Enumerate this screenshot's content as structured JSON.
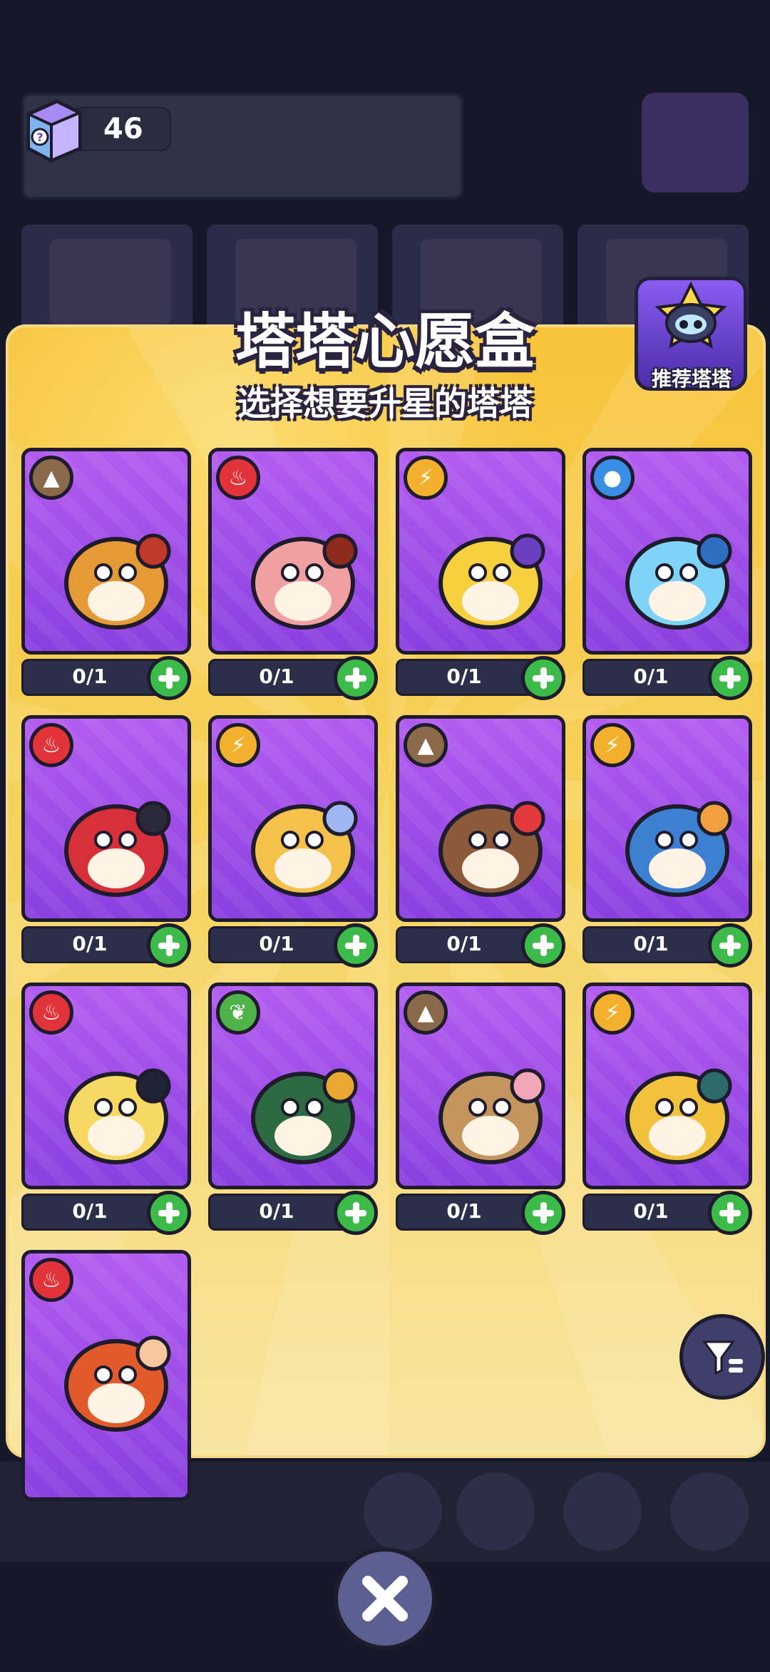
{
  "currency": {
    "value": "46",
    "icon": "wish-box-icon"
  },
  "modal": {
    "title": "塔塔心愿盒",
    "subtitle": "选择想要升星的塔塔",
    "recommend_label": "推荐塔塔"
  },
  "cards": [
    {
      "element": "earth",
      "count": "0/1",
      "colors": [
        "#e69a35",
        "#c0392b"
      ]
    },
    {
      "element": "fire",
      "count": "0/1",
      "colors": [
        "#f0a0a0",
        "#8e2a1c"
      ]
    },
    {
      "element": "thunder",
      "count": "0/1",
      "colors": [
        "#f7d040",
        "#6a3fc0"
      ]
    },
    {
      "element": "water",
      "count": "0/1",
      "colors": [
        "#7fd3f7",
        "#2f6fc2"
      ]
    },
    {
      "element": "fire",
      "count": "0/1",
      "colors": [
        "#d8303a",
        "#2a2a3a"
      ]
    },
    {
      "element": "thunder",
      "count": "0/1",
      "colors": [
        "#f4c24a",
        "#9fb6f2"
      ]
    },
    {
      "element": "earth",
      "count": "0/1",
      "colors": [
        "#8a5a3a",
        "#e23a3a"
      ]
    },
    {
      "element": "thunder",
      "count": "0/1",
      "colors": [
        "#3d7fd0",
        "#f0a040"
      ]
    },
    {
      "element": "fire",
      "count": "0/1",
      "colors": [
        "#f7d862",
        "#1e2335"
      ]
    },
    {
      "element": "grass",
      "count": "0/1",
      "colors": [
        "#2d6a44",
        "#e8a832"
      ]
    },
    {
      "element": "earth",
      "count": "0/1",
      "colors": [
        "#c59560",
        "#f0a8b8"
      ]
    },
    {
      "element": "thunder",
      "count": "0/1",
      "colors": [
        "#f2c23c",
        "#2d6a6a"
      ]
    },
    {
      "element": "fire",
      "count": "",
      "colors": [
        "#e35a2a",
        "#f7c8a0"
      ]
    }
  ],
  "element_icons": {
    "earth": "mountain-icon",
    "fire": "flame-icon",
    "thunder": "lightning-icon",
    "water": "droplet-icon",
    "grass": "leaf-icon"
  },
  "controls": {
    "filter_icon": "filter-icon",
    "close_icon": "close-icon"
  }
}
